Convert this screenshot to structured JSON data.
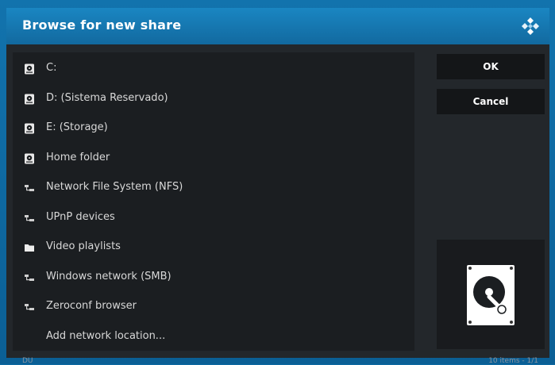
{
  "dialog": {
    "title": "Browse for new share",
    "logo_icon": "kodi-logo-icon"
  },
  "items": [
    {
      "label": "C:",
      "icon": "drive-icon"
    },
    {
      "label": "D: (Sistema Reservado)",
      "icon": "drive-icon"
    },
    {
      "label": "E: (Storage)",
      "icon": "drive-icon"
    },
    {
      "label": "Home folder",
      "icon": "drive-icon"
    },
    {
      "label": "Network File System (NFS)",
      "icon": "network-icon"
    },
    {
      "label": "UPnP devices",
      "icon": "network-icon"
    },
    {
      "label": "Video playlists",
      "icon": "folder-icon"
    },
    {
      "label": "Windows network (SMB)",
      "icon": "network-icon"
    },
    {
      "label": "Zeroconf browser",
      "icon": "network-icon"
    },
    {
      "label": "Add network location...",
      "icon": ""
    }
  ],
  "buttons": {
    "ok_label": "OK",
    "cancel_label": "Cancel"
  },
  "thumbnail": {
    "icon": "hard-drive-icon"
  },
  "footer": {
    "left_text": "DU",
    "right_text": "10 items - 1/1"
  },
  "colors": {
    "background": "#0d6aa3",
    "title_bar": "#1a86c2",
    "panel": "#1b1e21",
    "dialog": "#23272b",
    "button": "#141618",
    "text": "#d8d8d8"
  }
}
